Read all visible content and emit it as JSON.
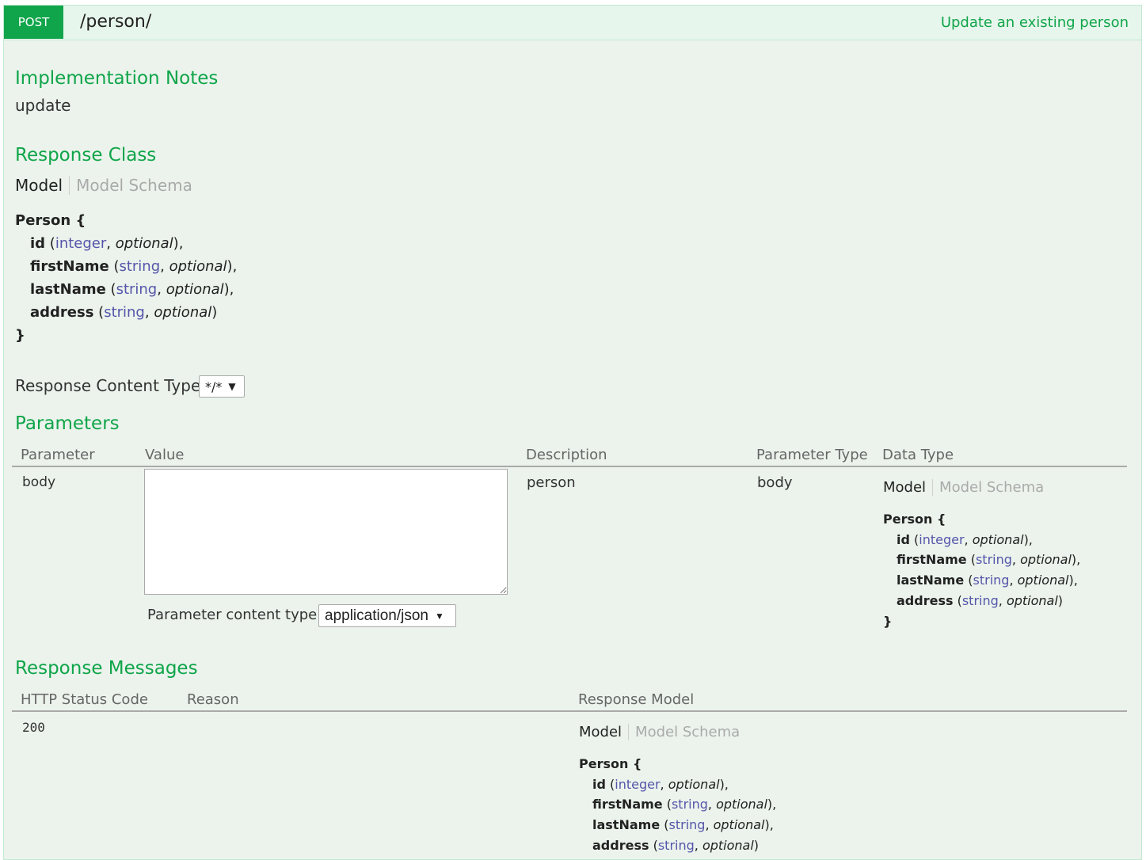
{
  "operation": {
    "method": "POST",
    "path": "/person/",
    "summary": "Update an existing person"
  },
  "implementation_notes": {
    "heading": "Implementation Notes",
    "text": "update"
  },
  "response_class": {
    "heading": "Response Class",
    "tabs": {
      "model": "Model",
      "schema": "Model Schema"
    },
    "model": {
      "name": "Person {",
      "close": "}",
      "props": [
        {
          "name": "id",
          "type": "integer",
          "optional": "optional",
          "sep": "),"
        },
        {
          "name": "firstName",
          "type": "string",
          "optional": "optional",
          "sep": "),"
        },
        {
          "name": "lastName",
          "type": "string",
          "optional": "optional",
          "sep": "),"
        },
        {
          "name": "address",
          "type": "string",
          "optional": "optional",
          "sep": ")"
        }
      ]
    }
  },
  "response_content_type": {
    "label": "Response Content Type",
    "value": "*/*"
  },
  "parameters": {
    "heading": "Parameters",
    "columns": [
      "Parameter",
      "Value",
      "Description",
      "Parameter Type",
      "Data Type"
    ],
    "row": {
      "parameter": "body",
      "value": "",
      "description": "person",
      "param_type": "body",
      "content_type_label": "Parameter content type:",
      "content_type_value": "application/json",
      "data_type_tabs": {
        "model": "Model",
        "schema": "Model Schema"
      }
    }
  },
  "response_messages": {
    "heading": "Response Messages",
    "columns": [
      "HTTP Status Code",
      "Reason",
      "Response Model"
    ],
    "row": {
      "code": "200",
      "reason": "",
      "tabs": {
        "model": "Model",
        "schema": "Model Schema"
      }
    }
  },
  "colors": {
    "accent_green": "#10a54a",
    "panel_bg": "#ebf3ec",
    "type_link": "#5555aa"
  }
}
